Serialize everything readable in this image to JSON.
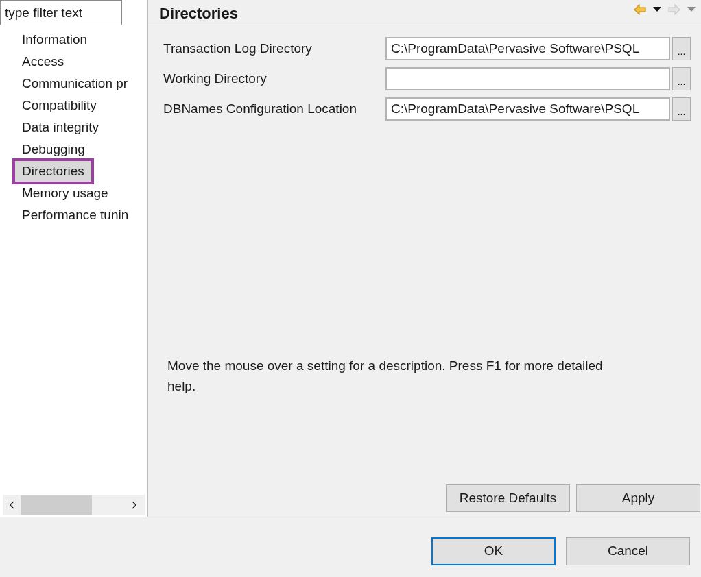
{
  "filter": {
    "placeholder": "type filter text"
  },
  "tree": {
    "items": [
      {
        "label": "Information",
        "selected": false
      },
      {
        "label": "Access",
        "selected": false
      },
      {
        "label": "Communication pr",
        "selected": false
      },
      {
        "label": "Compatibility",
        "selected": false
      },
      {
        "label": "Data integrity",
        "selected": false
      },
      {
        "label": "Debugging",
        "selected": false
      },
      {
        "label": "Directories",
        "selected": true
      },
      {
        "label": "Memory usage",
        "selected": false
      },
      {
        "label": "Performance tunin",
        "selected": false
      }
    ]
  },
  "page": {
    "title": "Directories",
    "nav": {
      "back_disabled": false,
      "forward_disabled": true
    },
    "settings": [
      {
        "label": "Transaction Log Directory",
        "value": "C:\\ProgramData\\Pervasive Software\\PSQL",
        "browse": "..."
      },
      {
        "label": "Working Directory",
        "browse": "..."
      },
      {
        "label": "DBNames Configuration Location",
        "value": "C:\\ProgramData\\Pervasive Software\\PSQL",
        "browse": "..."
      }
    ],
    "description": "Move the mouse over a setting for a description. Press F1 for more detailed help.",
    "buttons": [
      "Restore Defaults",
      "Apply"
    ]
  },
  "dialog_buttons": [
    {
      "label": "OK",
      "default": true
    },
    {
      "label": "Cancel",
      "default": false
    }
  ]
}
